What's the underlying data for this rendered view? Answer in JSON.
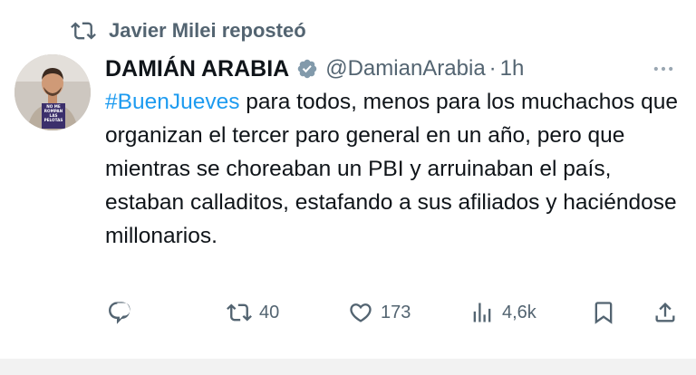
{
  "repost": {
    "label": "Javier Milei reposteó",
    "icon": "repost-icon"
  },
  "author": {
    "name": "DAMIÁN ARABIA",
    "handle": "@DamianArabia",
    "separator": "·",
    "time": "1h",
    "verified": true,
    "avatar_book_text": [
      "NO ME",
      "ROMPAN",
      "LAS",
      "PELOTAS"
    ]
  },
  "tweet": {
    "hashtag": "#BuenJueves",
    "body": " para todos, menos para los muchachos que organizan el tercer paro general en un año, pero que mientras se choreaban un PBI y arruinaban el país, estaban calladitos, estafando a sus afiliados y haciéndose millonarios."
  },
  "actions": {
    "reply": {
      "icon": "reply-icon",
      "count": ""
    },
    "repost": {
      "icon": "repost-icon",
      "count": "40"
    },
    "like": {
      "icon": "heart-icon",
      "count": "173"
    },
    "views": {
      "icon": "views-icon",
      "count": "4,6k"
    },
    "bookmark": {
      "icon": "bookmark-icon"
    },
    "share": {
      "icon": "share-icon"
    }
  },
  "colors": {
    "text": "#0f1419",
    "secondary": "#536471",
    "link": "#1d9bf0",
    "verified_badge": "#829aab"
  }
}
